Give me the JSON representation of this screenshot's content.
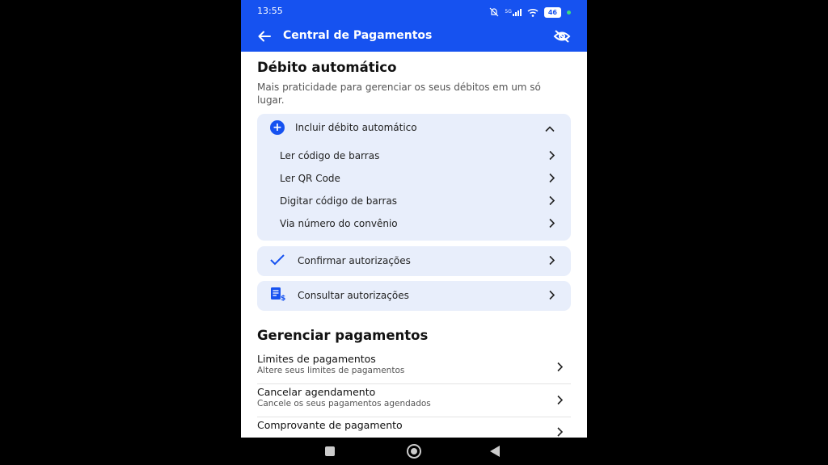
{
  "status": {
    "time": "13:55",
    "signal": "5G",
    "battery": "46"
  },
  "appbar": {
    "title": "Central de Pagamentos"
  },
  "debito": {
    "title": "Débito automático",
    "subtitle": "Mais praticidade para gerenciar os seus débitos em um só lugar.",
    "incluir": {
      "label": "Incluir débito automático",
      "options": [
        "Ler código de barras",
        "Ler QR Code",
        "Digitar código de barras",
        "Via número do convênio"
      ]
    },
    "confirmar": "Confirmar autorizações",
    "consultar": "Consultar autorizações"
  },
  "gerenciar": {
    "title": "Gerenciar pagamentos",
    "items": [
      {
        "title": "Limites de pagamentos",
        "subtitle": "Altere seus limites de pagamentos"
      },
      {
        "title": "Cancelar agendamento",
        "subtitle": "Cancele os seus pagamentos agendados"
      },
      {
        "title": "Comprovante de pagamento",
        "subtitle": ""
      }
    ]
  },
  "colors": {
    "primary": "#1652f0",
    "card": "#e8eefb"
  }
}
